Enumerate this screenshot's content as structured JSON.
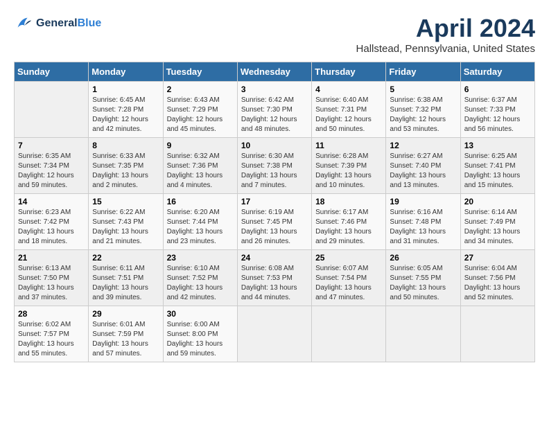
{
  "header": {
    "logo_line1": "General",
    "logo_line2": "Blue",
    "title": "April 2024",
    "location": "Hallstead, Pennsylvania, United States"
  },
  "calendar": {
    "days_of_week": [
      "Sunday",
      "Monday",
      "Tuesday",
      "Wednesday",
      "Thursday",
      "Friday",
      "Saturday"
    ],
    "weeks": [
      [
        {
          "day": "",
          "info": ""
        },
        {
          "day": "1",
          "info": "Sunrise: 6:45 AM\nSunset: 7:28 PM\nDaylight: 12 hours\nand 42 minutes."
        },
        {
          "day": "2",
          "info": "Sunrise: 6:43 AM\nSunset: 7:29 PM\nDaylight: 12 hours\nand 45 minutes."
        },
        {
          "day": "3",
          "info": "Sunrise: 6:42 AM\nSunset: 7:30 PM\nDaylight: 12 hours\nand 48 minutes."
        },
        {
          "day": "4",
          "info": "Sunrise: 6:40 AM\nSunset: 7:31 PM\nDaylight: 12 hours\nand 50 minutes."
        },
        {
          "day": "5",
          "info": "Sunrise: 6:38 AM\nSunset: 7:32 PM\nDaylight: 12 hours\nand 53 minutes."
        },
        {
          "day": "6",
          "info": "Sunrise: 6:37 AM\nSunset: 7:33 PM\nDaylight: 12 hours\nand 56 minutes."
        }
      ],
      [
        {
          "day": "7",
          "info": "Sunrise: 6:35 AM\nSunset: 7:34 PM\nDaylight: 12 hours\nand 59 minutes."
        },
        {
          "day": "8",
          "info": "Sunrise: 6:33 AM\nSunset: 7:35 PM\nDaylight: 13 hours\nand 2 minutes."
        },
        {
          "day": "9",
          "info": "Sunrise: 6:32 AM\nSunset: 7:36 PM\nDaylight: 13 hours\nand 4 minutes."
        },
        {
          "day": "10",
          "info": "Sunrise: 6:30 AM\nSunset: 7:38 PM\nDaylight: 13 hours\nand 7 minutes."
        },
        {
          "day": "11",
          "info": "Sunrise: 6:28 AM\nSunset: 7:39 PM\nDaylight: 13 hours\nand 10 minutes."
        },
        {
          "day": "12",
          "info": "Sunrise: 6:27 AM\nSunset: 7:40 PM\nDaylight: 13 hours\nand 13 minutes."
        },
        {
          "day": "13",
          "info": "Sunrise: 6:25 AM\nSunset: 7:41 PM\nDaylight: 13 hours\nand 15 minutes."
        }
      ],
      [
        {
          "day": "14",
          "info": "Sunrise: 6:23 AM\nSunset: 7:42 PM\nDaylight: 13 hours\nand 18 minutes."
        },
        {
          "day": "15",
          "info": "Sunrise: 6:22 AM\nSunset: 7:43 PM\nDaylight: 13 hours\nand 21 minutes."
        },
        {
          "day": "16",
          "info": "Sunrise: 6:20 AM\nSunset: 7:44 PM\nDaylight: 13 hours\nand 23 minutes."
        },
        {
          "day": "17",
          "info": "Sunrise: 6:19 AM\nSunset: 7:45 PM\nDaylight: 13 hours\nand 26 minutes."
        },
        {
          "day": "18",
          "info": "Sunrise: 6:17 AM\nSunset: 7:46 PM\nDaylight: 13 hours\nand 29 minutes."
        },
        {
          "day": "19",
          "info": "Sunrise: 6:16 AM\nSunset: 7:48 PM\nDaylight: 13 hours\nand 31 minutes."
        },
        {
          "day": "20",
          "info": "Sunrise: 6:14 AM\nSunset: 7:49 PM\nDaylight: 13 hours\nand 34 minutes."
        }
      ],
      [
        {
          "day": "21",
          "info": "Sunrise: 6:13 AM\nSunset: 7:50 PM\nDaylight: 13 hours\nand 37 minutes."
        },
        {
          "day": "22",
          "info": "Sunrise: 6:11 AM\nSunset: 7:51 PM\nDaylight: 13 hours\nand 39 minutes."
        },
        {
          "day": "23",
          "info": "Sunrise: 6:10 AM\nSunset: 7:52 PM\nDaylight: 13 hours\nand 42 minutes."
        },
        {
          "day": "24",
          "info": "Sunrise: 6:08 AM\nSunset: 7:53 PM\nDaylight: 13 hours\nand 44 minutes."
        },
        {
          "day": "25",
          "info": "Sunrise: 6:07 AM\nSunset: 7:54 PM\nDaylight: 13 hours\nand 47 minutes."
        },
        {
          "day": "26",
          "info": "Sunrise: 6:05 AM\nSunset: 7:55 PM\nDaylight: 13 hours\nand 50 minutes."
        },
        {
          "day": "27",
          "info": "Sunrise: 6:04 AM\nSunset: 7:56 PM\nDaylight: 13 hours\nand 52 minutes."
        }
      ],
      [
        {
          "day": "28",
          "info": "Sunrise: 6:02 AM\nSunset: 7:57 PM\nDaylight: 13 hours\nand 55 minutes."
        },
        {
          "day": "29",
          "info": "Sunrise: 6:01 AM\nSunset: 7:59 PM\nDaylight: 13 hours\nand 57 minutes."
        },
        {
          "day": "30",
          "info": "Sunrise: 6:00 AM\nSunset: 8:00 PM\nDaylight: 13 hours\nand 59 minutes."
        },
        {
          "day": "",
          "info": ""
        },
        {
          "day": "",
          "info": ""
        },
        {
          "day": "",
          "info": ""
        },
        {
          "day": "",
          "info": ""
        }
      ]
    ]
  }
}
